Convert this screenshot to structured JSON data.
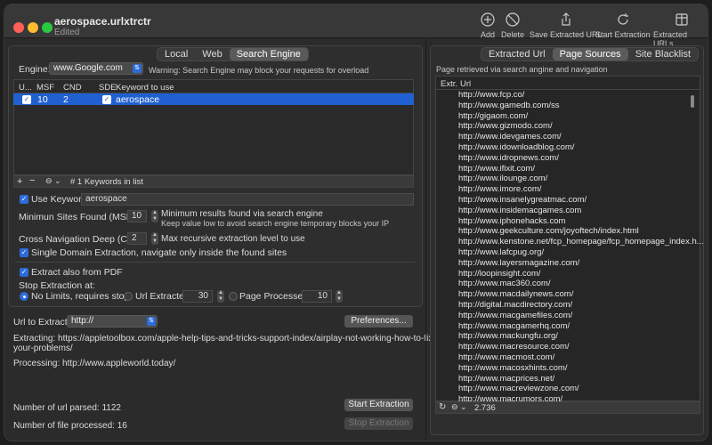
{
  "window": {
    "title": "aerospace.urlxtrctr",
    "subtitle": "Edited"
  },
  "toolbar": {
    "add": "Add",
    "delete": "Delete",
    "save": "Save Extracted URL",
    "start": "Start Extraction",
    "extracted_urls": "Extracted URLs"
  },
  "left_tabs": [
    "Local",
    "Web",
    "Search Engine"
  ],
  "engine": {
    "label": "Engine:",
    "value": "www.Google.com",
    "warning": "Warning: Search Engine may block your requests for overload"
  },
  "keyword_table": {
    "headers": [
      "U...",
      "MSF",
      "CND",
      "SDE",
      "Keyword to use"
    ],
    "row": {
      "msf": "10",
      "cnd": "2",
      "keyword": "aerospace"
    },
    "footer": "# 1 Keywords in list"
  },
  "settings": {
    "use_keyword_label": "Use Keyword:",
    "use_keyword_value": "aerospace",
    "msf_label": "Minimun Sites Found (MSF):",
    "msf_value": "10",
    "msf_help1": "Minimum results found via search engine",
    "msf_help2": "Keep value low to avoid search engine temporary blocks your IP",
    "cnd_label": "Cross Navigation Deep (CND):",
    "cnd_value": "2",
    "cnd_help": "Max recursive extraction level to use",
    "single_domain": "Single Domain Extraction, navigate only inside the found sites",
    "pdf": "Extract also from PDF",
    "stop_label": "Stop Extraction at:",
    "no_limits": "No Limits, requires stop",
    "url_extracted": "Url Extracted",
    "url_extracted_value": "30",
    "page_processed": "Page Processed",
    "page_processed_value": "10"
  },
  "bottom": {
    "url_label": "Url to Extract:",
    "url_value": "http://",
    "preferences": "Preferences...",
    "extracting": "Extracting: https://appletoolbox.com/apple-help-tips-and-tricks-support-index/airplay-not-working-how-to-fix-",
    "extracting2": "your-problems/",
    "processing": "Processing: http://www.appleworld.today/",
    "parsed": "Number of url parsed: 1122",
    "processed": "Number of file processed: 16",
    "start": "Start Extraction",
    "stop": "Stop Extraction"
  },
  "right_tabs": [
    "Extracted Url",
    "Page Sources",
    "Site Blacklist"
  ],
  "right": {
    "info": "Page retrieved via search angine and navigation",
    "col_extr": "Extr.",
    "col_url": "Url",
    "count": "2.736",
    "urls": [
      "http://www.fcp.co/",
      "http://www.gamedb.com/ss",
      "http://gigaom.com/",
      "http://www.gizmodo.com/",
      "http://www.idevgames.com/",
      "http://www.idownloadblog.com/",
      "http://www.idropnews.com/",
      "http://www.ifixit.com/",
      "http://www.ilounge.com/",
      "http://www.imore.com/",
      "http://www.insanelygreatmac.com/",
      "http://www.insidemacgames.com",
      "http://www.iphonehacks.com",
      "http://www.geekculture.com/joyoftech/index.html",
      "http://www.kenstone.net/fcp_homepage/fcp_homepage_index.h...",
      "http://www.lafcpug.org/",
      "http://www.layersmagazine.com/",
      "http://loopinsight.com/",
      "http://www.mac360.com/",
      "http://www.macdailynews.com/",
      "http://digital.macdirectory.com/",
      "http://www.macgamefiles.com/",
      "http://www.macgamerhq.com/",
      "http://www.mackungfu.org/",
      "http://www.macresource.com/",
      "http://www.macmost.com/",
      "http://www.macosxhints.com/",
      "http://www.macprices.net/",
      "http://www.macreviewzone.com/",
      "http://www.macrumors.com/"
    ]
  }
}
